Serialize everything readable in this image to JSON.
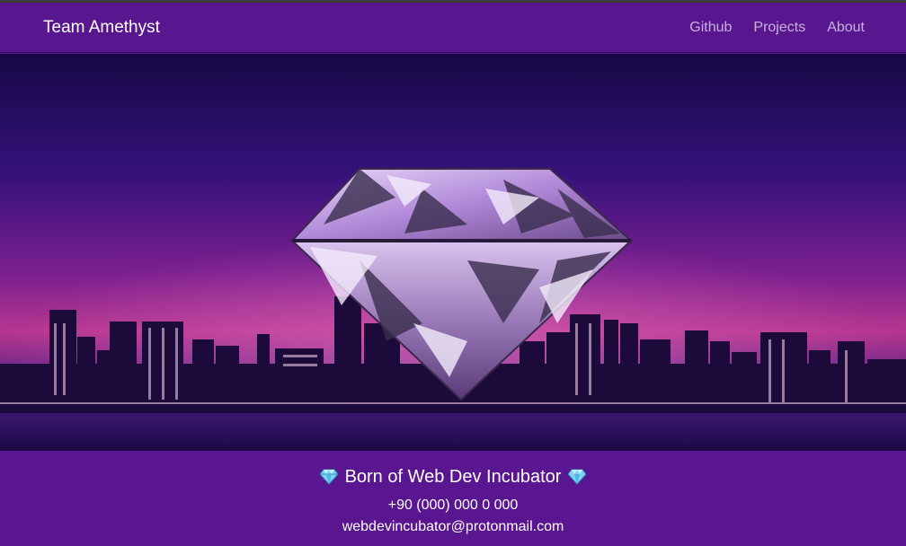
{
  "navbar": {
    "brand": "Team Amethyst",
    "links": [
      {
        "label": "Github"
      },
      {
        "label": "Projects"
      },
      {
        "label": "About"
      }
    ]
  },
  "hero": {
    "image_icon": "amethyst-diamond-over-city-skyline"
  },
  "footer": {
    "title": "Born of Web Dev Incubator",
    "gem_icon": "gem-icon",
    "phone": "+90 (000) 000 0 000",
    "email": "webdevincubator@protonmail.com"
  },
  "colors": {
    "navbar_bg": "#58168f",
    "footer_bg": "#5a1591",
    "nav_link": "#c8b2dc",
    "brand_text": "#ffffff"
  }
}
